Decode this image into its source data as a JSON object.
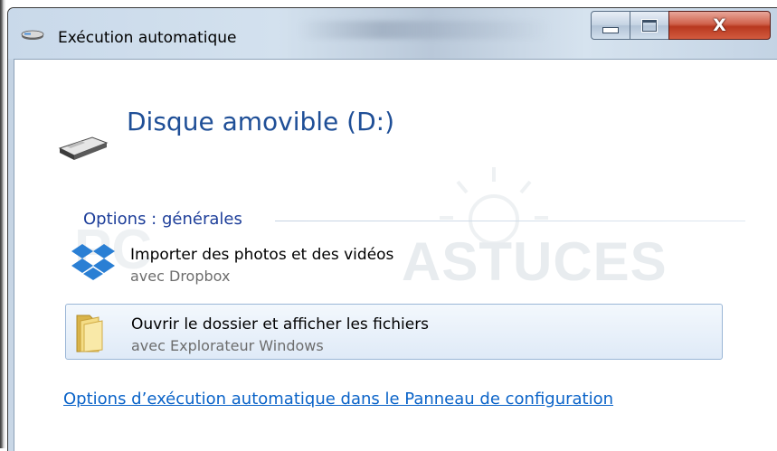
{
  "window": {
    "title": "Exécution automatique",
    "controls": {
      "minimize": "minimize",
      "maximize": "maximize",
      "close": "X"
    }
  },
  "device": {
    "title": "Disque amovible (D:)",
    "icon": "removable-drive-icon"
  },
  "section": {
    "heading": "Options : générales"
  },
  "options": [
    {
      "title": "Importer des photos et des vidéos",
      "subtitle": "avec Dropbox",
      "icon": "dropbox-icon",
      "selected": false
    },
    {
      "title": "Ouvrir le dossier et afficher les fichiers",
      "subtitle": "avec Explorateur Windows",
      "icon": "folder-icon",
      "selected": true
    }
  ],
  "footer": {
    "link": "Options d’exécution automatique dans le Panneau de configuration"
  },
  "watermark": {
    "text": "PC ASTUCES"
  },
  "colors": {
    "heading": "#1f4f97",
    "section": "#1e3f9a",
    "link": "#0a63c8",
    "selection_bg": "#dfeaf7",
    "selection_border": "#9ab6d6",
    "close_button": "#c7432a"
  }
}
